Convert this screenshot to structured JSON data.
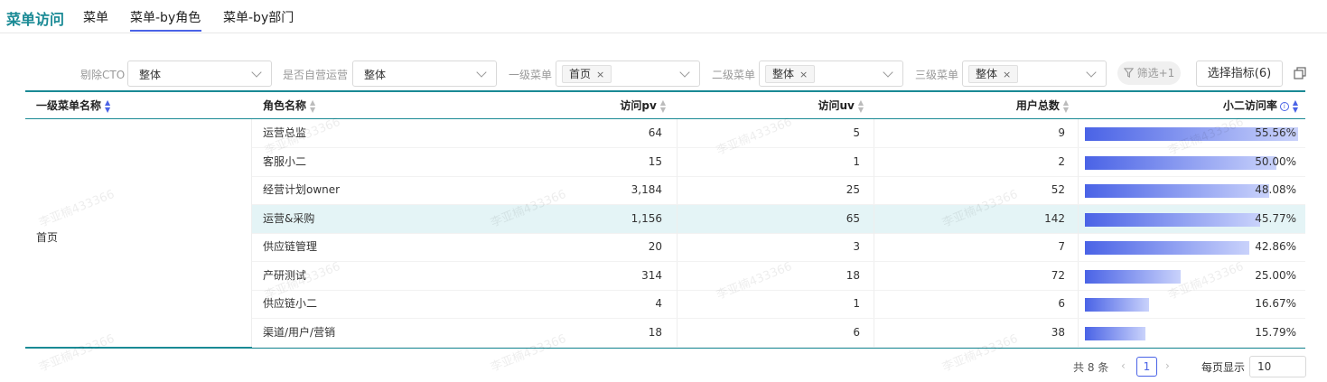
{
  "header": {
    "title": "菜单访问",
    "tabs": [
      {
        "label": "菜单"
      },
      {
        "label": "菜单-by角色"
      },
      {
        "label": "菜单-by部门"
      }
    ]
  },
  "filters": {
    "exclude_cto": {
      "label": "剔除CTO",
      "value": "整体"
    },
    "self_operated": {
      "label": "是否自营运营",
      "value": "整体"
    },
    "level1_menu": {
      "label": "一级菜单",
      "tag": "首页"
    },
    "level2_menu": {
      "label": "二级菜单",
      "tag": "整体"
    },
    "level3_menu": {
      "label": "三级菜单",
      "tag": "整体"
    },
    "filter_button": "筛选+1",
    "metrics_button": "选择指标(6)",
    "tag_close": "×"
  },
  "table": {
    "columns": [
      "一级菜单名称",
      "角色名称",
      "访问pv",
      "访问uv",
      "用户总数",
      "小二访问率"
    ],
    "merged_value": "首页",
    "rows": [
      {
        "role": "运营总监",
        "pv": "64",
        "uv": "5",
        "users": "9",
        "rate": "55.56%",
        "rate_value": 55.56
      },
      {
        "role": "客服小二",
        "pv": "15",
        "uv": "1",
        "users": "2",
        "rate": "50.00%",
        "rate_value": 50.0
      },
      {
        "role": "经营计划owner",
        "pv": "3,184",
        "uv": "25",
        "users": "52",
        "rate": "48.08%",
        "rate_value": 48.08
      },
      {
        "role": "运营&采购",
        "pv": "1,156",
        "uv": "65",
        "users": "142",
        "rate": "45.77%",
        "rate_value": 45.77
      },
      {
        "role": "供应链管理",
        "pv": "20",
        "uv": "3",
        "users": "7",
        "rate": "42.86%",
        "rate_value": 42.86
      },
      {
        "role": "产研测试",
        "pv": "314",
        "uv": "18",
        "users": "72",
        "rate": "25.00%",
        "rate_value": 25.0
      },
      {
        "role": "供应链小二",
        "pv": "4",
        "uv": "1",
        "users": "6",
        "rate": "16.67%",
        "rate_value": 16.67
      },
      {
        "role": "渠道/用户/营销",
        "pv": "18",
        "uv": "6",
        "users": "38",
        "rate": "15.79%",
        "rate_value": 15.79
      }
    ],
    "highlighted_row_index": 3,
    "max_rate": 55.56
  },
  "watermark": "李亚楠433366",
  "pagination": {
    "total": "共 8 条",
    "current": "1",
    "page_size_label": "每页显示",
    "page_size": "10"
  },
  "colors": {
    "accent": "#1a8a95",
    "primary": "#4a63e6",
    "highlight_row": "#e4f4f6"
  }
}
